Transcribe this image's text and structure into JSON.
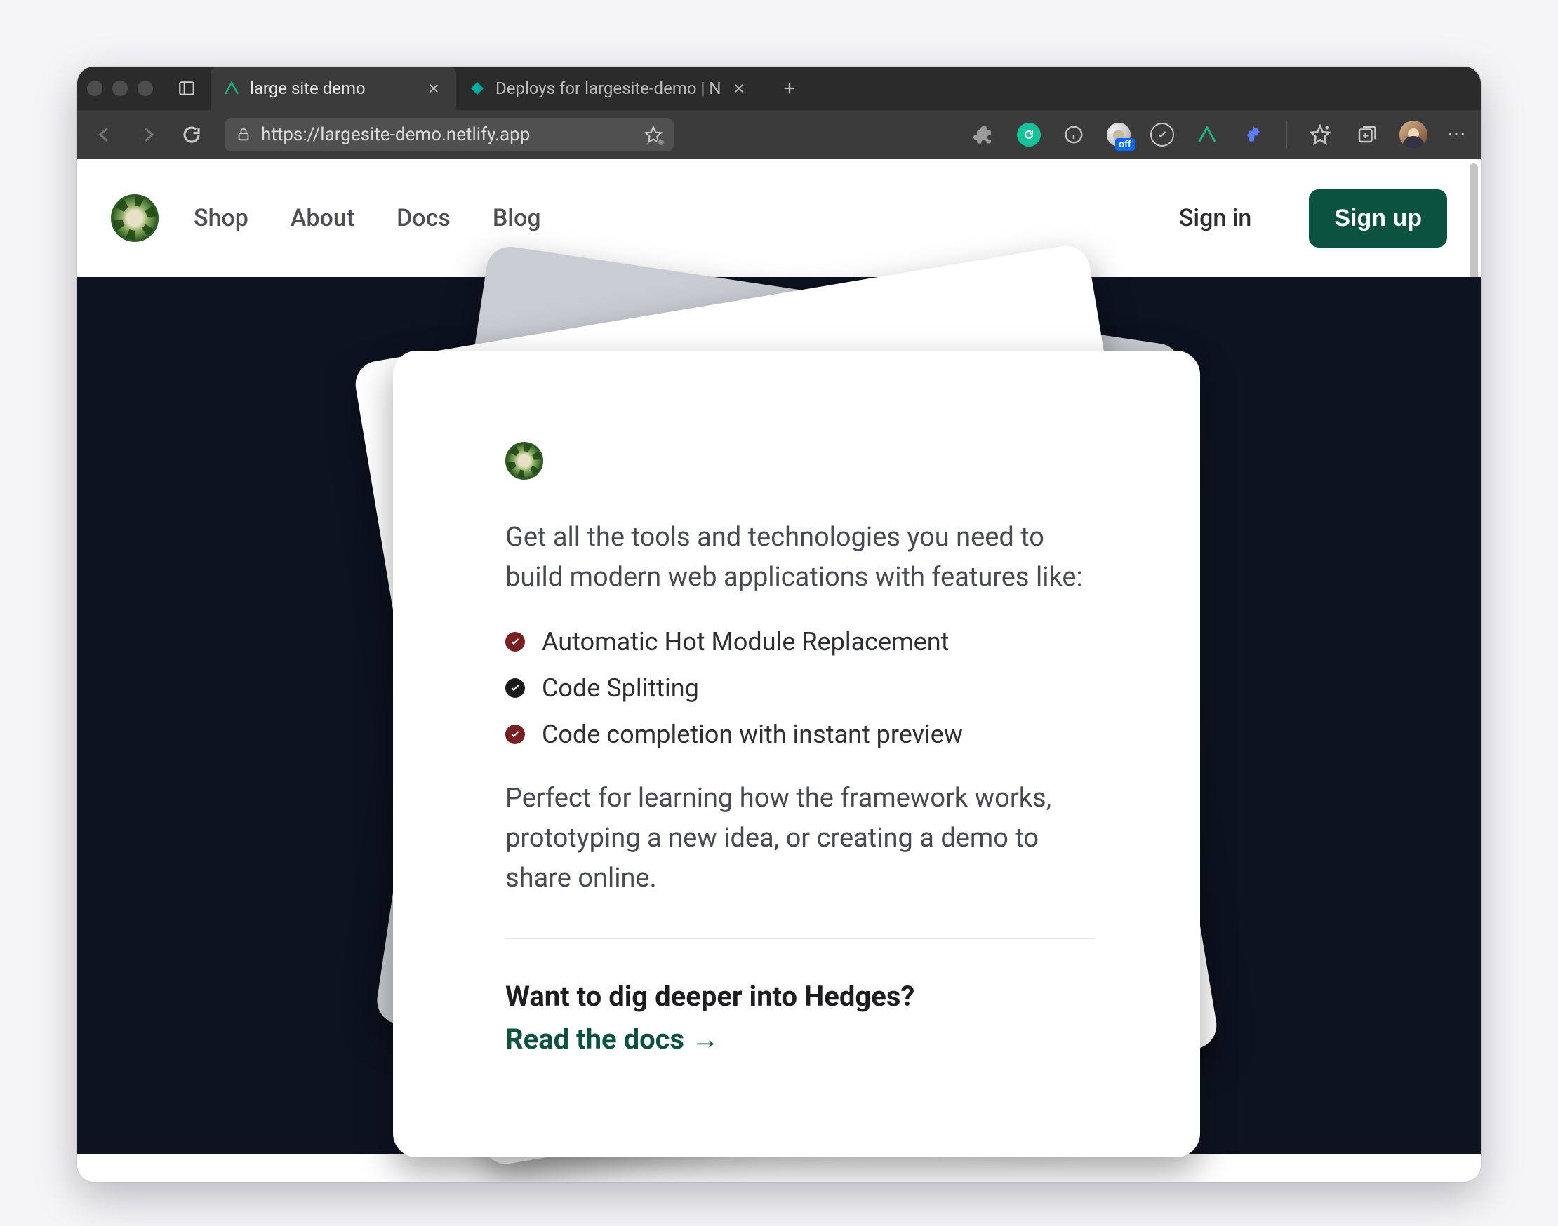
{
  "browser": {
    "tabs": [
      {
        "title": "large site demo",
        "active": true
      },
      {
        "title": "Deploys for largesite-demo | N",
        "active": false
      }
    ],
    "url": "https://largesite-demo.netlify.app",
    "badge_off": "off"
  },
  "site": {
    "nav": [
      "Shop",
      "About",
      "Docs",
      "Blog"
    ],
    "signin": "Sign in",
    "signup": "Sign up"
  },
  "hero": {
    "intro": "Get all the tools and technologies you need to build modern web applications with features like:",
    "features": [
      {
        "text": "Automatic Hot Module Replacement",
        "color": "maroon"
      },
      {
        "text": "Code Splitting",
        "color": "black"
      },
      {
        "text": "Code completion with instant preview",
        "color": "maroon"
      }
    ],
    "outro": "Perfect for learning how the framework works, prototyping a new idea, or creating a demo to share online.",
    "cta_heading": "Want to dig deeper into Hedges?",
    "docs_link": "Read the docs",
    "arrow": "→"
  }
}
